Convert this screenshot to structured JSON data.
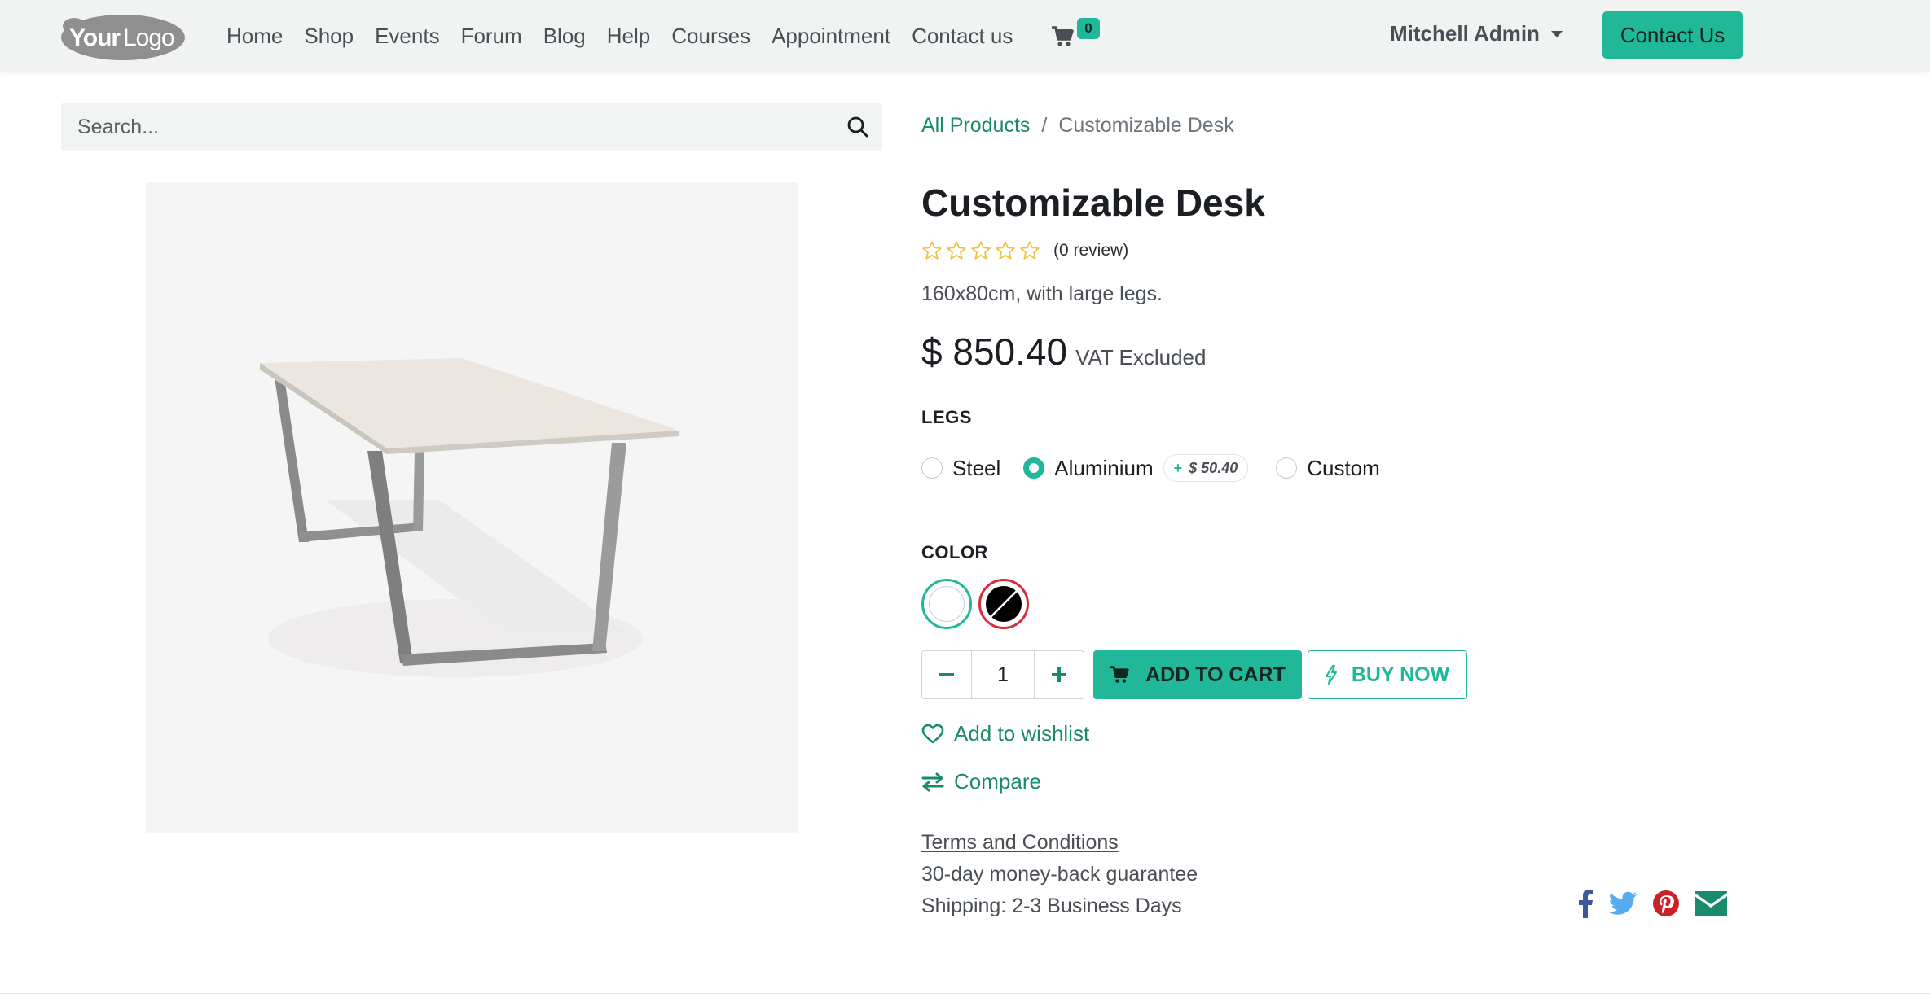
{
  "header": {
    "logo_text": "YourLogo",
    "nav": [
      "Home",
      "Shop",
      "Events",
      "Forum",
      "Blog",
      "Help",
      "Courses",
      "Appointment",
      "Contact us"
    ],
    "cart_count": "0",
    "user_name": "Mitchell Admin",
    "contact_button": "Contact Us"
  },
  "search": {
    "placeholder": "Search..."
  },
  "breadcrumb": {
    "parent": "All Products",
    "separator": "/",
    "current": "Customizable Desk"
  },
  "product": {
    "name": "Customizable Desk",
    "rating_stars": 0,
    "review_text": "(0 review)",
    "description": "160x80cm, with large legs.",
    "price": "$ 850.40",
    "price_note": "VAT Excluded"
  },
  "attributes": {
    "legs": {
      "title": "LEGS",
      "options": [
        {
          "label": "Steel",
          "checked": false
        },
        {
          "label": "Aluminium",
          "checked": true,
          "extra_sign": "+",
          "extra_price": "$ 50.40"
        },
        {
          "label": "Custom",
          "checked": false
        }
      ]
    },
    "color": {
      "title": "COLOR",
      "swatches": [
        {
          "name": "white",
          "selected": true
        },
        {
          "name": "black",
          "selected": false,
          "unavailable": true
        }
      ]
    }
  },
  "cart": {
    "quantity": "1",
    "add_to_cart": "ADD TO CART",
    "buy_now": "BUY NOW"
  },
  "links": {
    "wishlist": "Add to wishlist",
    "compare": "Compare",
    "terms": "Terms and Conditions",
    "guarantee": "30-day money-back guarantee",
    "shipping": "Shipping: 2-3 Business Days"
  },
  "social": [
    "facebook-icon",
    "twitter-icon",
    "pinterest-icon",
    "envelope-icon"
  ],
  "colors": {
    "primary": "#21b799",
    "link": "#1a8a6d",
    "header_bg": "#f0f3f2",
    "star": "#f3c13a",
    "facebook": "#3b5998",
    "twitter": "#55acee",
    "pinterest": "#cb2027",
    "email": "#1a8a6d"
  }
}
